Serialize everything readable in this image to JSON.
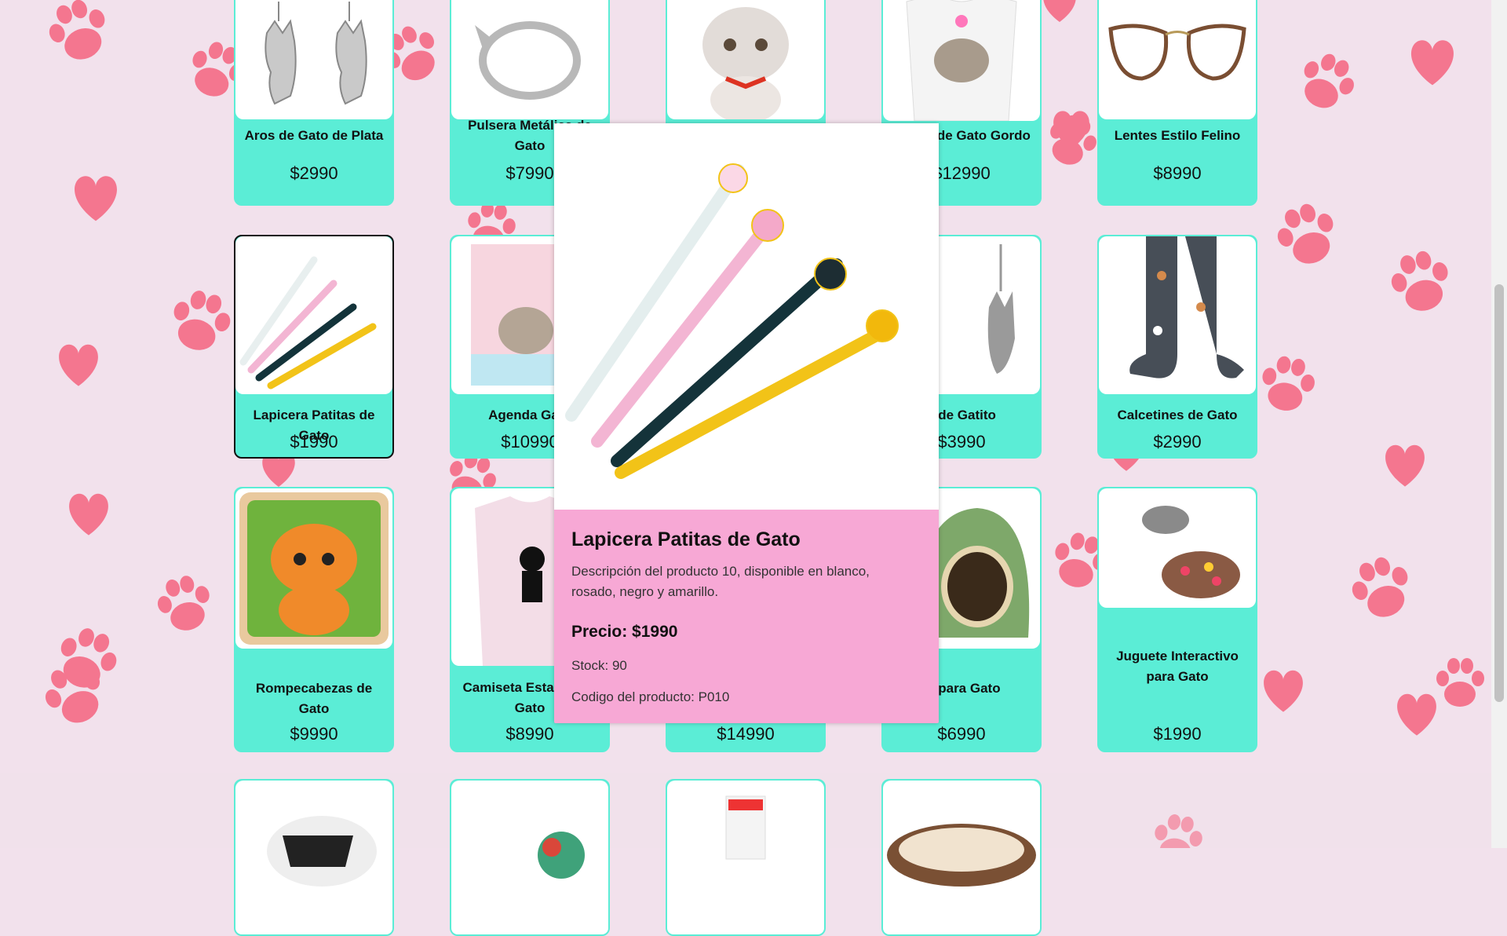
{
  "colors": {
    "background": "#f2e1ec",
    "pattern": "#f4768f",
    "card": "#5bedd6",
    "modal": "#f7a8d5"
  },
  "products": [
    {
      "name": "Aros de Gato de Plata",
      "price": "$2990",
      "icon": "cat-earrings-image"
    },
    {
      "name": "Pulsera Metálica de Gato",
      "price": "$7990",
      "icon": "cat-ring-image"
    },
    {
      "name": "",
      "price": "",
      "icon": "cat-plush-image"
    },
    {
      "name": "Polera de Gato Gordo",
      "price": "$12990",
      "icon": "cat-tshirt-image"
    },
    {
      "name": "Lentes Estilo Felino",
      "price": "$8990",
      "icon": "cat-eye-glasses-image"
    },
    {
      "name": "Lapicera Patitas de Gato",
      "price": "$1990",
      "icon": "paw-pens-image"
    },
    {
      "name": "Agenda Gato",
      "price": "$10990",
      "icon": "cat-notebook-image"
    },
    {
      "name": "",
      "price": "",
      "icon": "product-image"
    },
    {
      "name": "s de Gatito",
      "price": "$3990",
      "icon": "cat-charm-image"
    },
    {
      "name": "Calcetines de Gato",
      "price": "$2990",
      "icon": "cat-socks-image"
    },
    {
      "name": "Rompecabezas de Gato",
      "price": "$9990",
      "icon": "cat-puzzle-image"
    },
    {
      "name": "Camiseta Estampada Gato",
      "price": "$8990",
      "icon": "printed-tshirt-image"
    },
    {
      "name": "",
      "price": "$14990",
      "icon": "product-image"
    },
    {
      "name": "ta para Gato",
      "price": "$6990",
      "icon": "cat-bed-cave-image"
    },
    {
      "name": "Juguete Interactivo para Gato",
      "price": "$1990",
      "icon": "cat-toy-image"
    },
    {
      "name": "",
      "price": "",
      "icon": "cat-harness-image"
    },
    {
      "name": "",
      "price": "",
      "icon": "yarn-ball-image"
    },
    {
      "name": "",
      "price": "",
      "icon": "cat-food-bag-image"
    },
    {
      "name": "",
      "price": "",
      "icon": "round-cat-bed-image"
    }
  ],
  "modal": {
    "title": "Lapicera Patitas de Gato",
    "description": "Descripción del producto 10, disponible en blanco, rosado, negro y amarillo.",
    "price": "Precio: $1990",
    "stock": "Stock: 90",
    "code": "Codigo del producto: P010"
  }
}
